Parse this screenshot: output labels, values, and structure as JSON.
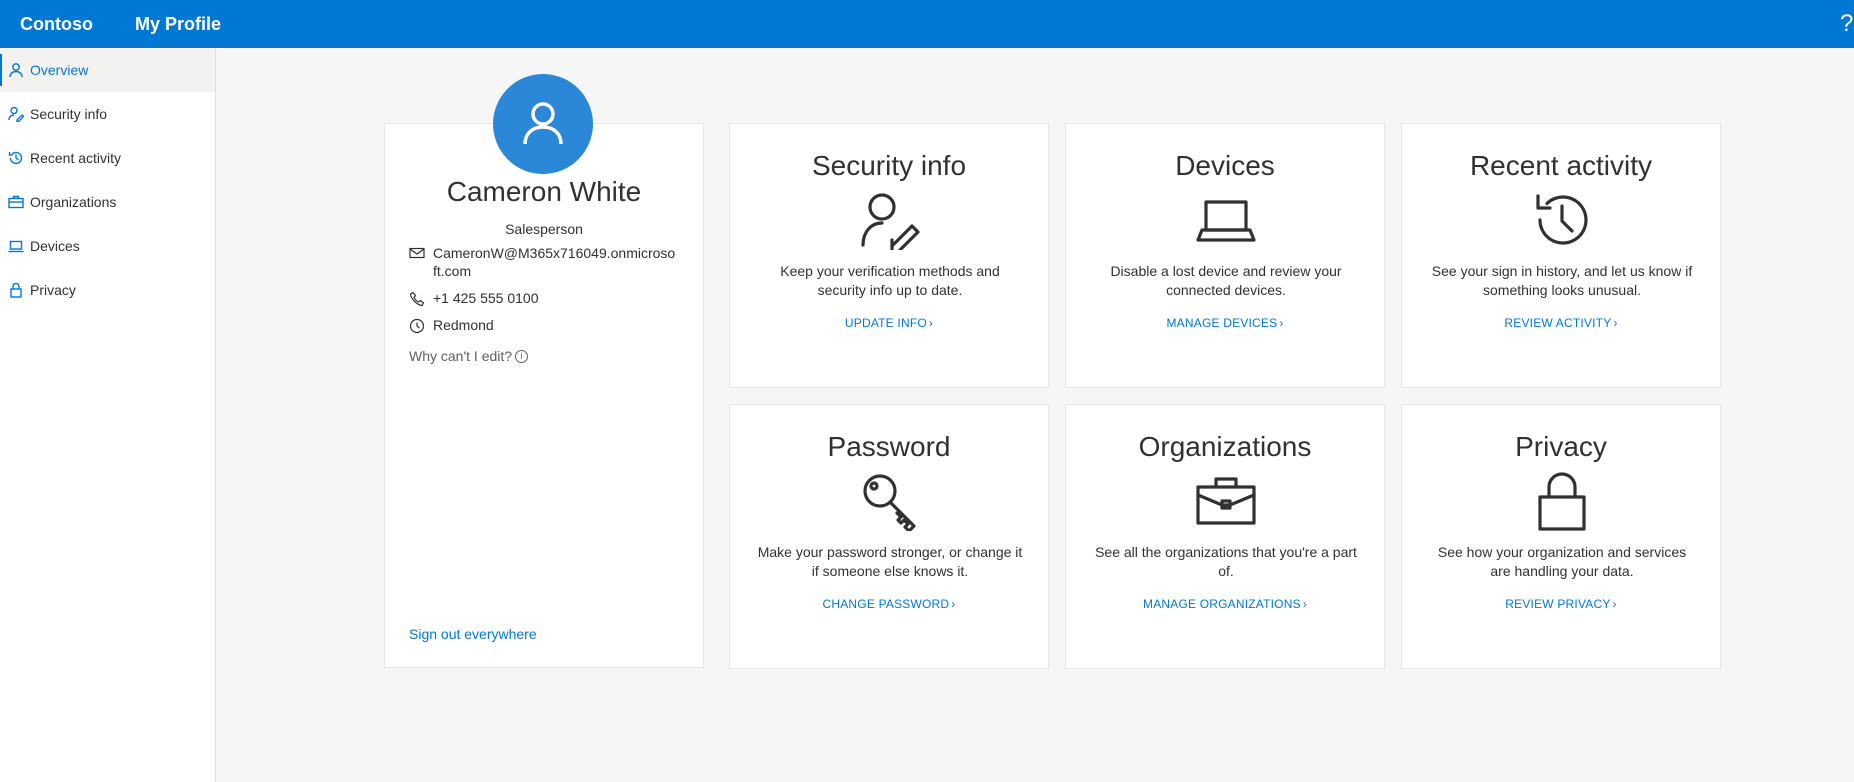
{
  "header": {
    "brand": "Contoso",
    "app_title": "My Profile",
    "help": "?"
  },
  "sidebar": {
    "items": [
      {
        "label": "Overview",
        "icon": "person-icon",
        "active": true
      },
      {
        "label": "Security info",
        "icon": "person-edit-icon"
      },
      {
        "label": "Recent activity",
        "icon": "history-icon"
      },
      {
        "label": "Organizations",
        "icon": "briefcase-icon"
      },
      {
        "label": "Devices",
        "icon": "laptop-icon"
      },
      {
        "label": "Privacy",
        "icon": "lock-icon"
      }
    ]
  },
  "profile": {
    "name": "Cameron White",
    "role": "Salesperson",
    "email": "CameronW@M365x716049.onmicrosoft.com",
    "phone": "+1 425 555 0100",
    "location": "Redmond",
    "why_edit": "Why can't I edit?",
    "sign_out": "Sign out everywhere"
  },
  "tiles": {
    "security": {
      "title": "Security info",
      "desc": "Keep your verification methods and security info up to date.",
      "link": "UPDATE INFO",
      "icon": "person-edit-icon"
    },
    "devices": {
      "title": "Devices",
      "desc": "Disable a lost device and review your connected devices.",
      "link": "MANAGE DEVICES",
      "icon": "laptop-icon"
    },
    "activity": {
      "title": "Recent activity",
      "desc": "See your sign in history, and let us know if something looks unusual.",
      "link": "REVIEW ACTIVITY",
      "icon": "history-icon"
    },
    "password": {
      "title": "Password",
      "desc": "Make your password stronger, or change it if someone else knows it.",
      "link": "CHANGE PASSWORD",
      "icon": "key-icon"
    },
    "orgs": {
      "title": "Organizations",
      "desc": "See all the organizations that you're a part of.",
      "link": "MANAGE ORGANIZATIONS",
      "icon": "briefcase-icon"
    },
    "privacy": {
      "title": "Privacy",
      "desc": "See how your organization and services are handling your data.",
      "link": "REVIEW PRIVACY",
      "icon": "lock-icon"
    }
  },
  "colors": {
    "accent": "#0078d4",
    "avatar": "#2b88d8"
  }
}
